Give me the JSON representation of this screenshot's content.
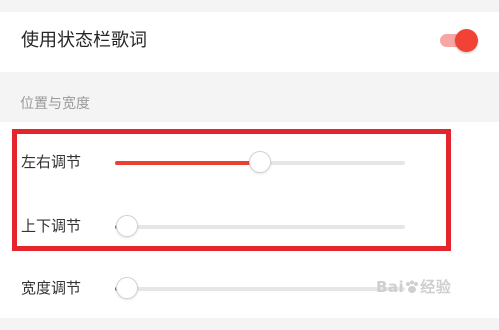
{
  "statusbar_lyrics": {
    "label": "使用状态栏歌词",
    "enabled": true
  },
  "section": {
    "title": "位置与宽度"
  },
  "sliders": [
    {
      "label": "左右调节",
      "value": 0.5
    },
    {
      "label": "上下调节",
      "value": 0.04
    },
    {
      "label": "宽度调节",
      "value": 0.04
    }
  ],
  "watermark": {
    "text_left": "Bai",
    "text_right": "经验"
  },
  "colors": {
    "accent": "#e84033",
    "toggle_on": "#f24236",
    "highlight": "#e4252c",
    "band": "#f4f4f4"
  }
}
